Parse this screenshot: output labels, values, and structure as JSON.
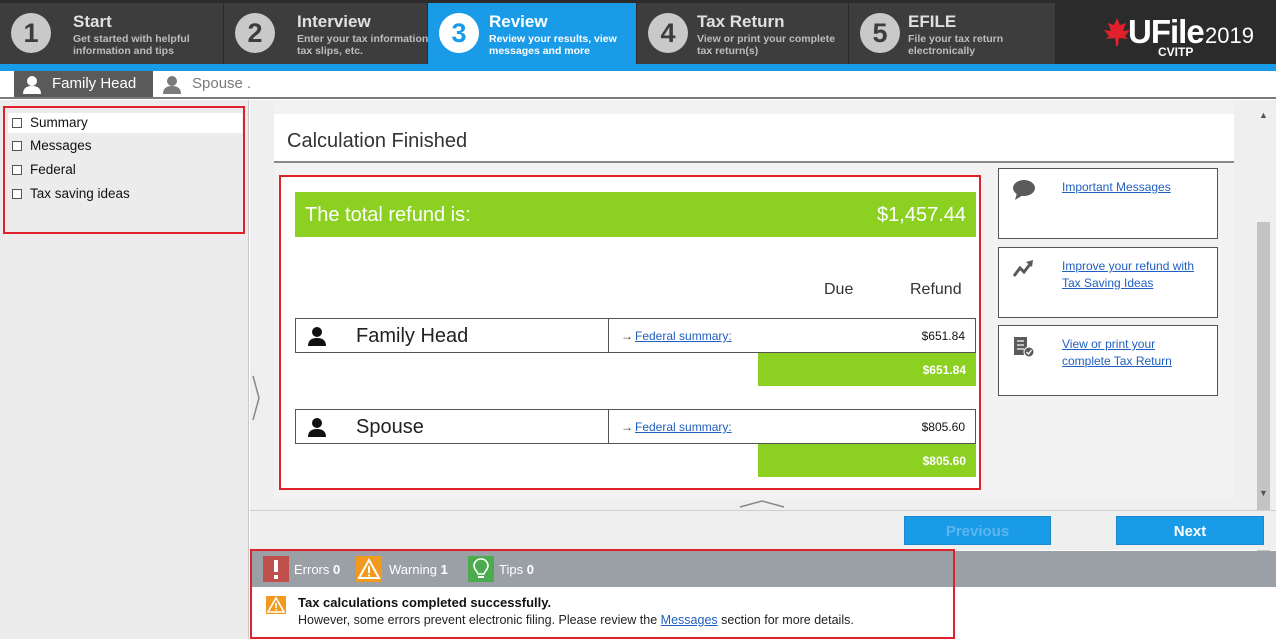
{
  "steps": [
    {
      "number": "1",
      "title": "Start",
      "desc": "Get started with helpful information and tips"
    },
    {
      "number": "2",
      "title": "Interview",
      "desc": "Enter your tax information, tax slips, etc."
    },
    {
      "number": "3",
      "title": "Review",
      "desc": "Review your results, view messages and more"
    },
    {
      "number": "4",
      "title": "Tax Return",
      "desc": "View or print your complete tax return(s)"
    },
    {
      "number": "5",
      "title": "EFILE",
      "desc": "File your tax return electronically"
    }
  ],
  "logo": {
    "brand": "UFile",
    "year": "2019",
    "edition": "CVITP"
  },
  "person_tabs": [
    {
      "label": "Family Head"
    },
    {
      "label": "Spouse ."
    }
  ],
  "sidebar": {
    "items": [
      {
        "label": "Summary"
      },
      {
        "label": "Messages"
      },
      {
        "label": "Federal"
      },
      {
        "label": "Tax saving ideas"
      }
    ]
  },
  "main": {
    "title": "Calculation Finished",
    "refund_label": "The total refund is:",
    "refund_total": "$1,457.44",
    "col_due": "Due",
    "col_refund": "Refund",
    "persons": [
      {
        "name": "Family Head",
        "arrow": "→",
        "link": "Federal summary:",
        "amount": "$651.84",
        "total": "$651.84"
      },
      {
        "name": "Spouse",
        "arrow": "→",
        "link": "Federal summary:",
        "amount": "$805.60",
        "total": "$805.60"
      }
    ]
  },
  "cards": [
    {
      "label": "Important Messages",
      "icon": "speech-bubble-icon"
    },
    {
      "label": "Improve your refund with Tax Saving Ideas",
      "icon": "trend-arrow-icon"
    },
    {
      "label": "View or print your complete Tax Return",
      "icon": "document-check-icon"
    }
  ],
  "buttons": {
    "previous": "Previous",
    "next": "Next"
  },
  "status": {
    "errors_label": "Errors",
    "errors_count": "0",
    "warning_label": "Warning",
    "warning_count": "1",
    "tips_label": "Tips",
    "tips_count": "0"
  },
  "message": {
    "title": "Tax calculations completed successfully.",
    "body_pre": "However, some errors prevent electronic filing. Please review the",
    "body_link": "Messages",
    "body_post": "section for more details."
  },
  "colors": {
    "accent_blue": "#1a9be8",
    "refund_green": "#8cd122",
    "highlight_red": "#e0202a"
  }
}
